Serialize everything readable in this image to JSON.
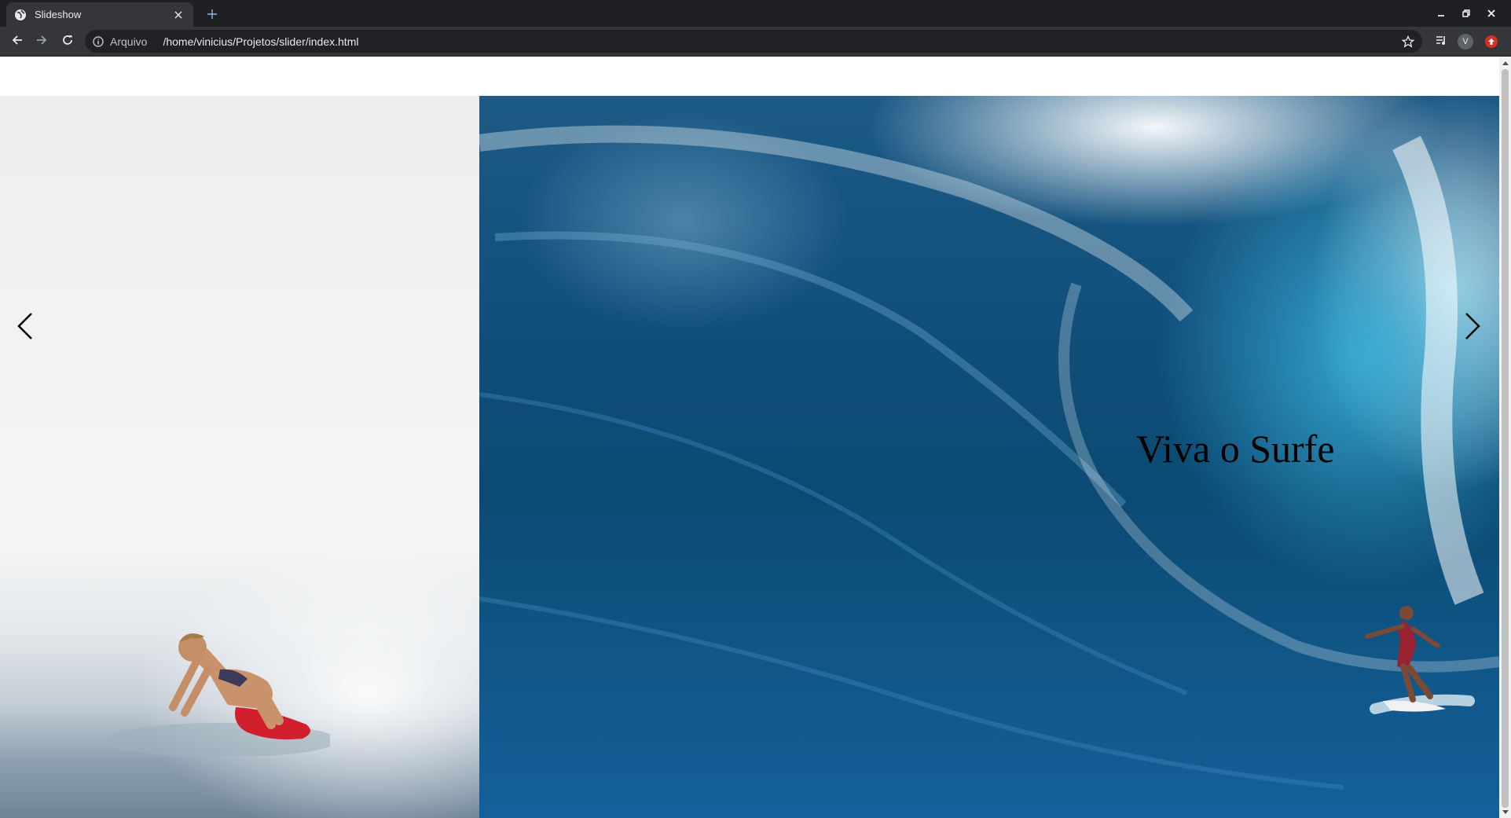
{
  "browser": {
    "tab_title": "Slideshow",
    "omnibox_scheme": "Arquivo",
    "omnibox_url": "/home/vinicius/Projetos/slider/index.html",
    "profile_initial": "V"
  },
  "icons": {
    "favicon": "globe-icon",
    "tab_close": "close-icon",
    "new_tab": "plus-icon",
    "back": "arrow-left-icon",
    "forward": "arrow-right-icon",
    "reload": "reload-icon",
    "info": "info-icon",
    "bookmark": "star-icon",
    "media": "media-queue-icon",
    "extension": "extension-icon",
    "minimize": "minimize-icon",
    "maximize": "maximize-icon",
    "window_close": "window-close-icon",
    "prev": "chevron-left-icon",
    "next": "chevron-right-icon"
  },
  "slideshow": {
    "caption": "Viva o Surfe",
    "prev_symbol": "‹",
    "next_symbol": "›"
  },
  "colors": {
    "chrome_dark": "#1f2023",
    "toolbar": "#35363a",
    "omnibox": "#202124",
    "caption_text": "#000000",
    "ocean_blue": "#0b4a72",
    "board_red": "#d21f2e"
  }
}
